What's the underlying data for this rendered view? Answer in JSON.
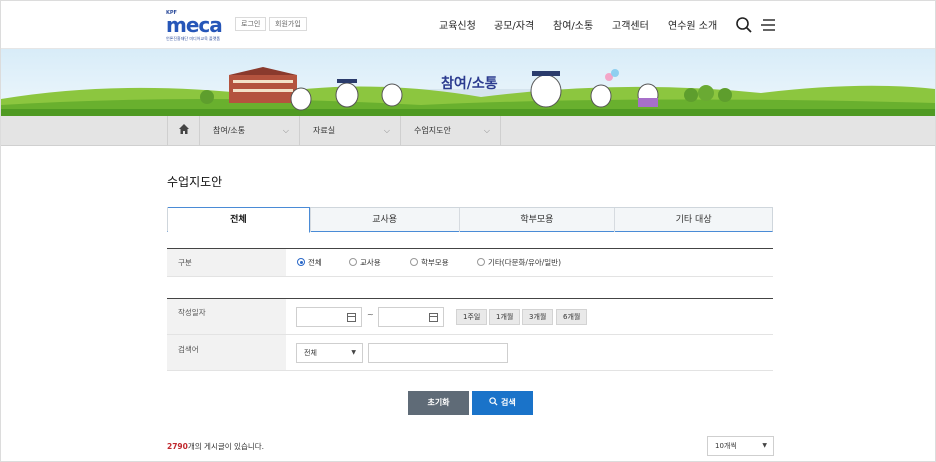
{
  "header": {
    "logo": {
      "kpf": "KPF",
      "word": "meca",
      "sub": "언론진흥재단 미디어교육 플랫폼"
    },
    "util": {
      "login": "로그인",
      "join": "회원가입"
    },
    "nav": [
      "교육신청",
      "공모/자격",
      "참여/소통",
      "고객센터",
      "연수원 소개"
    ]
  },
  "banner": {
    "title": "참여/소통"
  },
  "breadcrumb": {
    "level1": "참여/소통",
    "level2": "자료실",
    "level3": "수업지도안"
  },
  "page_title": "수업지도안",
  "tabs": [
    "전체",
    "교사용",
    "학부모용",
    "기타 대상"
  ],
  "filter": {
    "category_label": "구분",
    "category_options": [
      "전체",
      "교사용",
      "학부모용",
      "기타(다문화/유아/일반)"
    ],
    "date_label": "작성일자",
    "date_sep": "~",
    "periods": [
      "1주일",
      "1개월",
      "3개월",
      "6개월"
    ],
    "search_label": "검색어",
    "search_scope": "전체"
  },
  "buttons": {
    "reset": "초기화",
    "search": "검색"
  },
  "result": {
    "count": "2790",
    "suffix": "개의 게시글이 있습니다.",
    "page_size": "10개씩"
  },
  "colors": {
    "accent": "#1a73c9",
    "reset_btn": "#5f6b77",
    "count": "#c0282d"
  }
}
